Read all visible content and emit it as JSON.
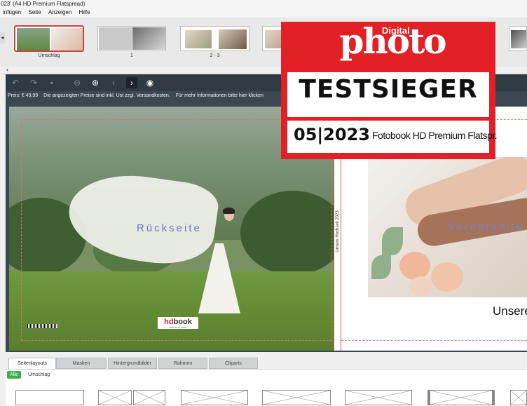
{
  "window": {
    "title": "023' (A4 HD Premium Flatspread)"
  },
  "menu": {
    "items": [
      "infügen",
      "Seite",
      "Anzeigen",
      "Hilfe"
    ]
  },
  "page_strip": {
    "thumbs": [
      {
        "label": "Umschlag"
      },
      {
        "label": "1"
      },
      {
        "label": "2 - 3"
      }
    ]
  },
  "toolbar": {
    "icons": [
      "undo-icon",
      "redo-icon",
      "save-icon",
      "zoom-out-icon",
      "zoom-in-icon",
      "prev-page-icon",
      "next-page-icon",
      "preview-eye-icon"
    ]
  },
  "price_bar": {
    "price": "Preis: € 49,99",
    "info": "Die angezeigten Preise sind inkl. Ust zzgl. Versandkosten.",
    "more": "Für mehr Informationen bitte hier klicken"
  },
  "cover": {
    "back_label": "Rückseite",
    "front_label": "Vorderseite",
    "spine_text": "Unsere Hochzeit 2023",
    "front_title": "Unsere",
    "logo": {
      "hd": "hd",
      "book": "book",
      "tag": "powered by Saxoo"
    }
  },
  "badge": {
    "brand_top": "Digital",
    "brand": "photo",
    "award": "TESTSIEGER",
    "issue": "05|2023",
    "product": "Fotobook HD Premium Flatspr."
  },
  "bottom": {
    "tabs": [
      "Seitenlayouts",
      "Masken",
      "Hintergrundbilder",
      "Rahmen",
      "Cliparts"
    ],
    "filter_all": "Alle",
    "filter_cover": "Umschlag"
  },
  "colors": {
    "accent": "#c9444a",
    "badge_red": "#e32026",
    "editor_bg": "#3b4751",
    "green_chip": "#3cae4a"
  }
}
